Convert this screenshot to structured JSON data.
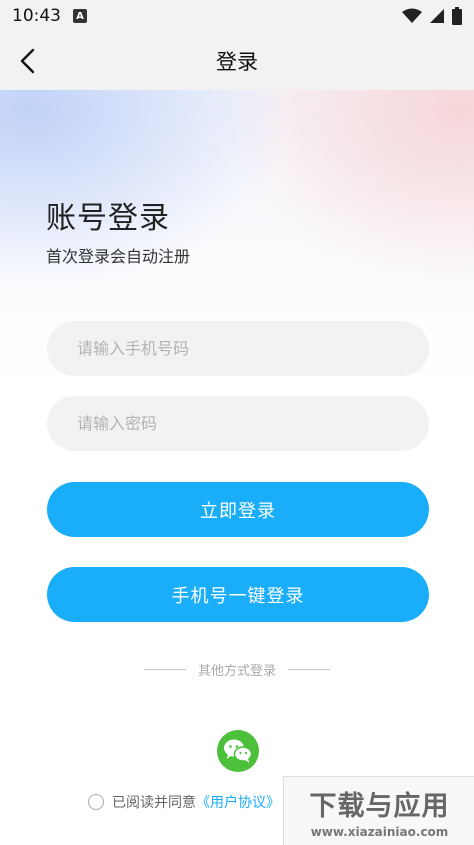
{
  "status_bar": {
    "time": "10:43",
    "app_indicator": "A",
    "icons": [
      "wifi-icon",
      "signal-icon",
      "battery-icon"
    ]
  },
  "nav": {
    "title": "登录",
    "back_icon": "chevron-left-icon"
  },
  "login": {
    "title": "账号登录",
    "subtitle": "首次登录会自动注册",
    "phone_placeholder": "请输入手机号码",
    "password_placeholder": "请输入密码",
    "login_button": "立即登录",
    "one_click_button": "手机号一键登录"
  },
  "other_login": {
    "label": "其他方式登录",
    "wechat_icon": "wechat-icon"
  },
  "agreement": {
    "prefix": "已阅读并同意",
    "link": "《用户协议》"
  },
  "watermark": {
    "main": "下载与应用",
    "url": "www.xiazainiao.com"
  },
  "colors": {
    "accent": "#1aaefa",
    "wechat": "#4cbf3b",
    "input_bg": "#f2f2f2"
  }
}
